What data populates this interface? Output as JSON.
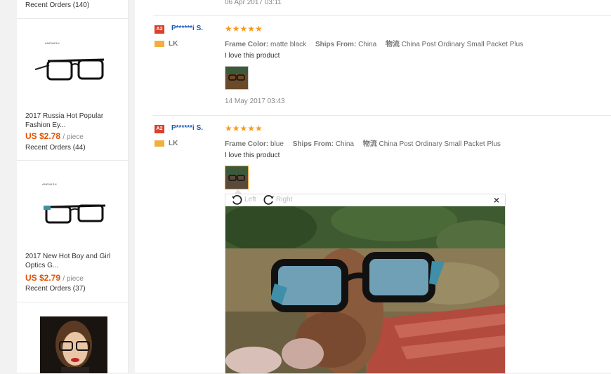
{
  "sidebar": {
    "top_orders": "Recent Orders (140)",
    "cards": [
      {
        "brand": "ANEWISH",
        "title": "2017 Russia Hot Popular Fashion Ey...",
        "price": "US $2.78",
        "unit": "/ piece",
        "orders": "Recent Orders (44)"
      },
      {
        "brand": "ANEWISH",
        "title": "2017 New Hot Boy and Girl Optics G...",
        "price": "US $2.79",
        "unit": "/ piece",
        "orders": "Recent Orders (37)"
      }
    ]
  },
  "reviews": {
    "prev_date": "06 Apr 2017 03:11",
    "items": [
      {
        "level": "A2",
        "user": "P******i S.",
        "country": "LK",
        "stars": "★★★★★",
        "color_label": "Frame Color:",
        "color_value": "matte black",
        "ships_label": "Ships From:",
        "ships_value": "China",
        "logistics_label": "物流",
        "logistics_value": "China Post Ordinary Small Packet Plus",
        "text": "I love this product",
        "date": "14 May 2017 03:43"
      },
      {
        "level": "A2",
        "user": "P******i S.",
        "country": "LK",
        "stars": "★★★★★",
        "color_label": "Frame Color:",
        "color_value": "blue",
        "ships_label": "Ships From:",
        "ships_value": "China",
        "logistics_label": "物流",
        "logistics_value": "China Post Ordinary Small Packet Plus",
        "text": "I love this product"
      }
    ]
  },
  "viewer": {
    "rotate_left": "Left",
    "rotate_right": "Right",
    "close": "×"
  }
}
